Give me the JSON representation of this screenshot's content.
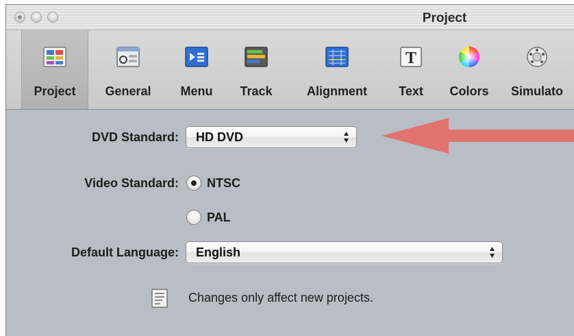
{
  "window": {
    "title": "Project"
  },
  "toolbar": {
    "items": [
      {
        "label": "Project",
        "icon": "project-grid-icon",
        "selected": true
      },
      {
        "label": "General",
        "icon": "general-prefs-icon"
      },
      {
        "label": "Menu",
        "icon": "menu-icon"
      },
      {
        "label": "Track",
        "icon": "track-timeline-icon"
      },
      {
        "label": "Alignment",
        "icon": "alignment-grid-icon"
      },
      {
        "label": "Text",
        "icon": "text-t-icon"
      },
      {
        "label": "Colors",
        "icon": "color-wheel-icon"
      },
      {
        "label": "Simulato",
        "icon": "simulator-dial-icon"
      }
    ]
  },
  "form": {
    "dvd_standard_label": "DVD Standard:",
    "dvd_standard_value": "HD DVD",
    "video_standard_label": "Video Standard:",
    "video_options": [
      {
        "label": "NTSC",
        "selected": true
      },
      {
        "label": "PAL",
        "selected": false
      }
    ],
    "default_language_label": "Default Language:",
    "default_language_value": "English",
    "note": "Changes only affect new projects."
  },
  "annotation": {
    "arrow_color": "#e0736d"
  }
}
